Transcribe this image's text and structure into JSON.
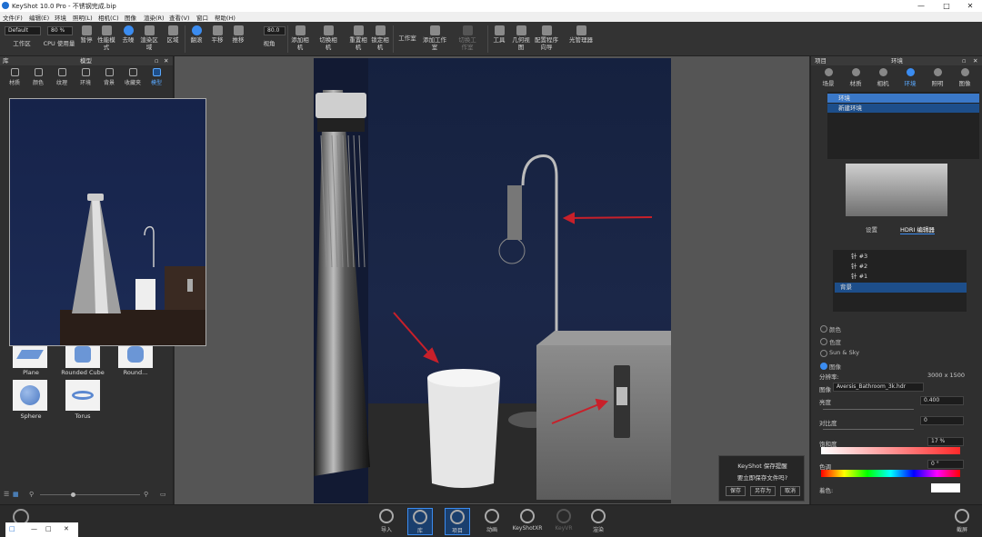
{
  "window": {
    "title": "KeyShot 10.0 Pro - 不锈钢完成.bip",
    "minimize": "—",
    "maximize": "□",
    "close": "✕"
  },
  "menu": [
    "文件(F)",
    "编辑(E)",
    "环境",
    "照明(L)",
    "相机(C)",
    "图像",
    "渲染(R)",
    "查看(V)",
    "窗口",
    "帮助(H)"
  ],
  "toolbar": {
    "preset_value": "Default",
    "percent_value": "80 %",
    "fov_value": "80.0",
    "items": [
      "工作区",
      "CPU 使用量",
      "暂停",
      "性能模式",
      "去噪",
      "渲染区域",
      "区域",
      "翻滚",
      "平移",
      "推移",
      "视角",
      "添加相机",
      "切换相机",
      "重置相机",
      "锁定相机",
      "工作室",
      "添加工作室",
      "切换工作室",
      "工具",
      "几何视图",
      "配置程序向导",
      "光管理器"
    ]
  },
  "left_panel": {
    "title": "库",
    "sub_title": "模型",
    "tabs": [
      "材质",
      "颜色",
      "纹理",
      "环境",
      "背景",
      "收藏夹",
      "模型"
    ],
    "models": [
      "Plane",
      "Rounded Cube",
      "Round...",
      "Sphere",
      "Torus"
    ]
  },
  "right_panel": {
    "title": "项目",
    "sub_title": "环境",
    "tabs": [
      "场景",
      "材质",
      "相机",
      "环境",
      "照明",
      "图像"
    ],
    "environments": [
      "环境",
      "新建环境"
    ],
    "subtabs": [
      "设置",
      "HDRI 编辑器"
    ],
    "layers": [
      "针 #3",
      "针 #2",
      "针 #1",
      "背景"
    ],
    "background_options": [
      "颜色",
      "色度",
      "Sun & Sky",
      "图像"
    ],
    "resolution_label": "分辨率:",
    "resolution_value": "3000 x 1500",
    "image_label": "图像",
    "image_file": "Aversis_Bathroom_3k.hdr",
    "brightness_label": "亮度",
    "brightness_value": "0.400",
    "contrast_label": "对比度",
    "contrast_value": "0",
    "saturation_label": "饱和度",
    "saturation_value": "17 %",
    "hue_label": "色调",
    "hue_value": "0 °",
    "tint_label": "着色:"
  },
  "dialog": {
    "title": "KeyShot 保存提醒",
    "message": "要立即保存文件吗?",
    "buttons": [
      "保存",
      "另存为",
      "取消"
    ]
  },
  "bottom_bar": [
    "导入",
    "库",
    "项目",
    "动画",
    "KeyShotXR",
    "KeyVR",
    "渲染",
    "截屏"
  ],
  "taskbar": {
    "labels": [
      "□",
      "—",
      "□",
      "✕"
    ]
  },
  "colors": {
    "accent": "#3b8cf0",
    "selection": "#1d4e8a",
    "arrow": "#c8202a"
  }
}
